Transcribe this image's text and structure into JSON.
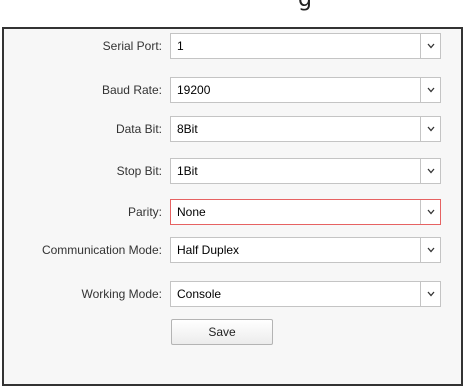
{
  "window": {
    "top_fragment": "g"
  },
  "form": {
    "fields": [
      {
        "label": "Serial Port:",
        "value": "1"
      },
      {
        "label": "Baud Rate:",
        "value": "19200"
      },
      {
        "label": "Data Bit:",
        "value": "8Bit"
      },
      {
        "label": "Stop Bit:",
        "value": "1Bit"
      },
      {
        "label": "Parity:",
        "value": "None"
      },
      {
        "label": "Communication Mode:",
        "value": "Half Duplex"
      },
      {
        "label": "Working Mode:",
        "value": "Console"
      }
    ],
    "save_label": "Save"
  },
  "icons": {
    "dropdown": "chevron-down-icon"
  },
  "colors": {
    "invalid_border": "#e66262",
    "panel_bg": "#f7f7f7",
    "panel_border": "#333333"
  }
}
